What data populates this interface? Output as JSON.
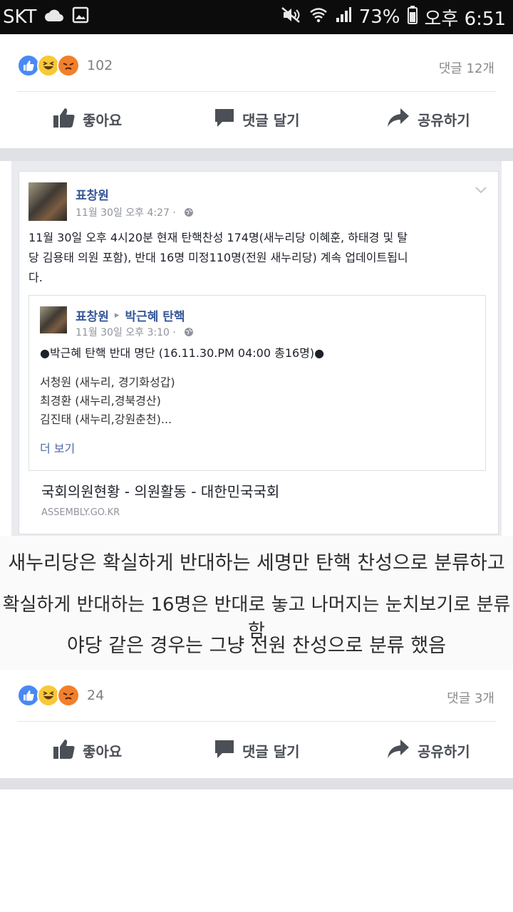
{
  "status_bar": {
    "carrier": "SKT",
    "battery": "73%",
    "time": "오후 6:51"
  },
  "top_card": {
    "reaction_count": "102",
    "comment_count": "댓글 12개",
    "actions": {
      "like": "좋아요",
      "comment": "댓글 달기",
      "share": "공유하기"
    }
  },
  "shared_post": {
    "author": "표창원",
    "timestamp": "11월 30일 오후 4:27 ·",
    "body_lines": [
      "11월 30일 오후 4시20분 현재 탄핵찬성 174명(새누리당 이혜훈, 하태경 및 탈",
      "당 김용태 의원 포함), 반대 16명 미정110명(전원 새누리당) 계속 업데이트됩니",
      "다."
    ],
    "quoted": {
      "author": "표창원",
      "arrow": "▸",
      "group": "박근혜 탄핵",
      "timestamp": "11월 30일 오후 3:10 ·",
      "headline": "●박근혜 탄핵 반대 명단 (16.11.30.PM 04:00 총16명)●",
      "lines": [
        "서청원 (새누리, 경기화성갑)",
        "최경환 (새누리,경북경산)",
        "김진태 (새누리,강원춘천)..."
      ],
      "see_more": "더 보기"
    },
    "link": {
      "title": "국회의원현황 - 의원활동 - 대한민국국회",
      "domain": "ASSEMBLY.GO.KR"
    }
  },
  "caption": {
    "lines": [
      "새누리당은 확실하게 반대하는 세명만 탄핵 찬성으로 분류하고",
      "확실하게 반대하는 16명은 반대로 놓고 나머지는 눈치보기로 분류함",
      "야당 같은 경우는 그냥 전원 찬성으로 분류 했음"
    ]
  },
  "bottom_card": {
    "reaction_count": "24",
    "comment_count": "댓글 3개",
    "actions": {
      "like": "좋아요",
      "comment": "댓글 달기",
      "share": "공유하기"
    }
  },
  "colors": {
    "like_blue": "#4a89f3",
    "link_blue": "#365899",
    "action_gray": "#4b4f56"
  }
}
